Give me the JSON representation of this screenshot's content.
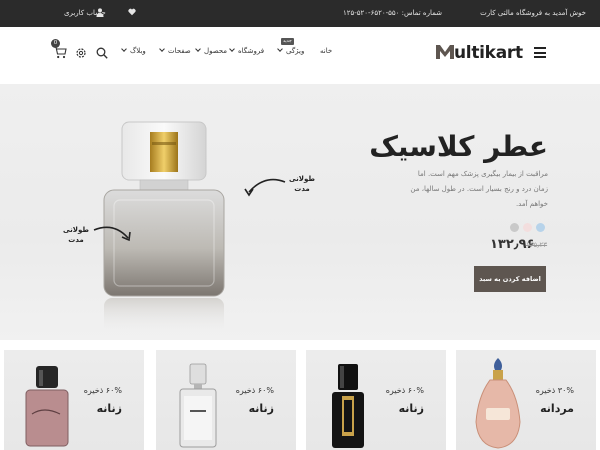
{
  "topbar": {
    "welcome": "خوش آمدید به فروشگاه مالتی کارت",
    "phone": "شماره تماس: ۵۵۰-۶۵۲۰-۵۲۰-۱۲۵",
    "account": "حساب کاربری",
    "icons": [
      "user-icon",
      "heart-icon",
      "phone-icon"
    ]
  },
  "header": {
    "logo_m": "M",
    "logo_rest": "ultikart",
    "nav": [
      {
        "label": "خانه",
        "has_chevron": false
      },
      {
        "label": "ویژگی",
        "has_chevron": true
      },
      {
        "label": "فروشگاه",
        "has_chevron": true
      },
      {
        "label": "محصول",
        "has_chevron": true
      },
      {
        "label": "صفحات",
        "has_chevron": true
      },
      {
        "label": "وبلاگ",
        "has_chevron": true
      }
    ],
    "nav_badge": "جدید",
    "cart_count": "0",
    "icons": [
      "menu-icon",
      "search-icon",
      "gear-icon",
      "cart-icon"
    ]
  },
  "hero": {
    "title": "عطر کلاسیک",
    "description": "مراقبت از بیمار بیگیری پزشک مهم است. اما زمان درد و رنج بسیار است. در طول سالها، من خواهم آمد.",
    "annotation_1": "طولانی مدت",
    "annotation_2": "طولانی مدت",
    "swatch_colors": [
      "#b7d3ea",
      "#f3dede",
      "#c9c9c9"
    ],
    "price_now": "۱۳۲٫۹۶",
    "price_old": "۱۴۵٫۲۳",
    "add_button": "اضافه کردن به سبد"
  },
  "cards": [
    {
      "discount": "۳۰% ذخیره",
      "category": "مردانه"
    },
    {
      "discount": "۶۰% ذخیره",
      "category": "زنانه"
    },
    {
      "discount": "۶۰% ذخیره",
      "category": "زنانه"
    },
    {
      "discount": "۶۰% ذخیره",
      "category": "زنانه"
    }
  ],
  "colors": {
    "topbar_bg": "#2b2b2b",
    "accent_button": "#5e5650",
    "hero_bg": "#ededed"
  }
}
